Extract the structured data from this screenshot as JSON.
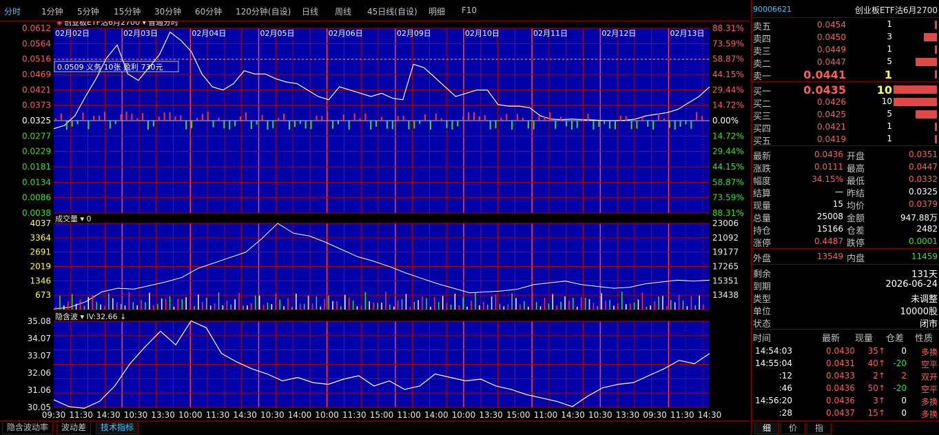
{
  "top_tabs": [
    "分时",
    "1分钟",
    "5分钟",
    "15分钟",
    "30分钟",
    "60分钟",
    "120分钟(自设)",
    "日线",
    "周线",
    "45日线(自设)",
    "明细",
    "F10"
  ],
  "chart_header": {
    "symbol_label": "创业板ETF沽6月2700",
    "mode_label": "普通分时"
  },
  "crosshair_label": "0.0509 义务 10张 盈利 730元",
  "dates": [
    "02月02日",
    "02月03日",
    "02月04日",
    "02月05日",
    "02月06日",
    "02月09日",
    "02月10日",
    "02月11日",
    "02月12日",
    "02月13日"
  ],
  "price_axis": {
    "left": [
      "0.0612",
      "0.0564",
      "0.0516",
      "0.0469",
      "0.0421",
      "0.0373",
      "0.0325",
      "0.0277",
      "0.0229",
      "0.0181",
      "0.0134",
      "0.0086",
      "0.0038"
    ],
    "right": [
      "88.31%",
      "73.59%",
      "58.87%",
      "44.15%",
      "29.44%",
      "14.72%",
      "0.00%",
      "14.72%",
      "29.44%",
      "44.15%",
      "58.87%",
      "73.59%",
      "88.31%"
    ]
  },
  "volume_panel": {
    "title": "成交量",
    "value": "0",
    "left": [
      "4037",
      "3364",
      "2691",
      "2019",
      "1346",
      "673"
    ],
    "right": [
      "23006",
      "21092",
      "19177",
      "17265",
      "15351",
      "13438"
    ]
  },
  "iv_panel": {
    "title": "隐含波",
    "iv_label": "IV:32.66",
    "axis": [
      "35.08",
      "34.07",
      "33.07",
      "32.06",
      "31.06",
      "30.05"
    ]
  },
  "time_axis": [
    "09:30",
    "11:30",
    "14:30",
    "10:30",
    "13:30",
    "10:00",
    "11:30",
    "14:30",
    "10:30",
    "14:00",
    "10:00",
    "11:30",
    "15:00",
    "11:00",
    "14:00",
    "10:00",
    "13:30",
    "15:00",
    "11:00",
    "14:30",
    "10:30",
    "13:30",
    "09:30",
    "11:30",
    "14:30"
  ],
  "bottom_tabs": [
    "隐含波动率",
    "波动差",
    "技术指标"
  ],
  "chart_colors": {
    "bg": "#0000a8",
    "grid": "#b00000",
    "up": "#ff3030",
    "down": "#33e02a",
    "price": "#ffffff",
    "avg": "#ffff40"
  },
  "chart_data": {
    "type": "line",
    "price": {
      "series": [
        {
          "name": "price",
          "values": [
            0.03,
            0.031,
            0.034,
            0.04,
            0.0455,
            0.052,
            0.056,
            0.047,
            0.045,
            0.049,
            0.053,
            0.06,
            0.0575,
            0.054,
            0.047,
            0.043,
            0.042,
            0.044,
            0.048,
            0.047,
            0.047,
            0.0455,
            0.0445,
            0.044,
            0.042,
            0.04,
            0.039,
            0.043,
            0.042,
            0.041,
            0.04,
            0.041,
            0.0395,
            0.039,
            0.05,
            0.049,
            0.046,
            0.043,
            0.04,
            0.041,
            0.042,
            0.042,
            0.0375,
            0.037,
            0.037,
            0.0365,
            0.034,
            0.033,
            0.0328,
            0.033,
            0.0328,
            0.0327,
            0.0325,
            0.0325,
            0.0326,
            0.033,
            0.034,
            0.0345,
            0.035,
            0.036,
            0.038,
            0.04,
            0.043
          ]
        }
      ],
      "ylim": [
        0.0038,
        0.0612
      ]
    },
    "volume": {
      "ylim": [
        0,
        4037
      ],
      "open_interest": {
        "values": [
          13500,
          13700,
          14300,
          15400,
          15800,
          15700,
          16100,
          16500,
          17000,
          18000,
          18600,
          19200,
          19800,
          21300,
          23006,
          21900,
          21600,
          20900,
          20100,
          19300,
          18800,
          18200,
          17500,
          16900,
          16300,
          15800,
          15300,
          15400,
          15500,
          15700,
          16200,
          16400,
          16600,
          16200,
          16000,
          15800,
          15900,
          16300,
          16500,
          16700,
          16600,
          16700
        ],
        "ylim": [
          13438,
          23006
        ]
      }
    },
    "iv": {
      "series": [
        {
          "name": "IV",
          "values": [
            30.5,
            30.1,
            30.0,
            30.4,
            31.3,
            32.6,
            33.6,
            34.5,
            33.7,
            35.1,
            34.7,
            33.2,
            32.7,
            32.3,
            32.0,
            31.6,
            31.8,
            31.5,
            31.4,
            31.7,
            31.9,
            31.3,
            31.6,
            31.1,
            31.3,
            32.0,
            31.8,
            31.6,
            31.7,
            31.3,
            31.1,
            30.8,
            30.6,
            30.4,
            30.1,
            30.7,
            31.2,
            31.4,
            31.5,
            31.9,
            32.3,
            32.8,
            32.6,
            33.2
          ],
          "ylim": [
            30.05,
            35.08
          ]
        }
      ]
    }
  },
  "side": {
    "code": "90006621",
    "name": "创业板ETF沽6月2700",
    "asks": [
      {
        "label": "卖五",
        "price": "0.0454",
        "vol": "1",
        "bar": 0.05
      },
      {
        "label": "卖四",
        "price": "0.0450",
        "vol": "3",
        "bar": 0.3
      },
      {
        "label": "卖三",
        "price": "0.0449",
        "vol": "1",
        "bar": 0.05
      },
      {
        "label": "卖二",
        "price": "0.0447",
        "vol": "5",
        "bar": 0.5
      },
      {
        "label": "卖一",
        "price": "0.0441",
        "vol": "1",
        "bar": 0.05
      }
    ],
    "bids": [
      {
        "label": "买一",
        "price": "0.0435",
        "vol": "10",
        "bar": 1.0
      },
      {
        "label": "买二",
        "price": "0.0426",
        "vol": "10",
        "bar": 1.0
      },
      {
        "label": "买三",
        "price": "0.0425",
        "vol": "5",
        "bar": 0.5
      },
      {
        "label": "买四",
        "price": "0.0421",
        "vol": "1",
        "bar": 0.05
      },
      {
        "label": "买五",
        "price": "0.0419",
        "vol": "1",
        "bar": 0.05
      }
    ],
    "quotes": [
      {
        "a": "最新",
        "av": "0.0436",
        "ac": "red",
        "b": "开盘",
        "bv": "0.0351",
        "bc": "red"
      },
      {
        "a": "涨跌",
        "av": "0.0111",
        "ac": "red",
        "b": "最高",
        "bv": "0.0447",
        "bc": "red"
      },
      {
        "a": "幅度",
        "av": "34.15%",
        "ac": "red",
        "b": "最低",
        "bv": "0.0332",
        "bc": "red"
      },
      {
        "a": "结算",
        "av": "—",
        "ac": "white",
        "b": "昨结",
        "bv": "0.0325",
        "bc": "white"
      },
      {
        "a": "现量",
        "av": "15",
        "ac": "white",
        "b": "均价",
        "bv": "0.0379",
        "bc": "red"
      },
      {
        "a": "总量",
        "av": "25008",
        "ac": "white",
        "b": "金额",
        "bv": "947.88万",
        "bc": "white"
      },
      {
        "a": "持仓",
        "av": "15166",
        "ac": "white",
        "b": "仓差",
        "bv": "2482",
        "bc": "white"
      },
      {
        "a": "涨停",
        "av": "0.4487",
        "ac": "red",
        "b": "跌停",
        "bv": "0.0001",
        "bc": "green"
      }
    ],
    "outer": {
      "a": "外盘",
      "av": "13549",
      "b": "内盘",
      "bv": "11459"
    },
    "info": [
      {
        "a": "剩余",
        "av": "131天"
      },
      {
        "a": "到期",
        "av": "2026-06-24"
      },
      {
        "a": "类型",
        "av": "未调整"
      },
      {
        "a": "单位",
        "av": "10000股"
      },
      {
        "a": "状态",
        "av": "闭市"
      }
    ],
    "trade_header": [
      "时间",
      "最新",
      "现量",
      "仓差",
      "性质"
    ],
    "trades": [
      {
        "t": "14:54:03",
        "p": "0.0430",
        "v": "35↑",
        "d": "0",
        "n": "多换"
      },
      {
        "t": "14:55:04",
        "p": "0.0431",
        "v": "40↑",
        "d": "-20",
        "n": "空平"
      },
      {
        "t": ":12",
        "p": "0.0433",
        "v": "2↑",
        "d": "2",
        "n": "双开"
      },
      {
        "t": ":46",
        "p": "0.0436",
        "v": "50↑",
        "d": "-20",
        "n": "空平"
      },
      {
        "t": "14:56:20",
        "p": "0.0436",
        "v": "3↑",
        "d": "0",
        "n": "多换"
      },
      {
        "t": ":28",
        "p": "0.0437",
        "v": "15↑",
        "d": "0",
        "n": "多换"
      }
    ],
    "side_tabs": [
      "细",
      "价",
      "指"
    ]
  }
}
